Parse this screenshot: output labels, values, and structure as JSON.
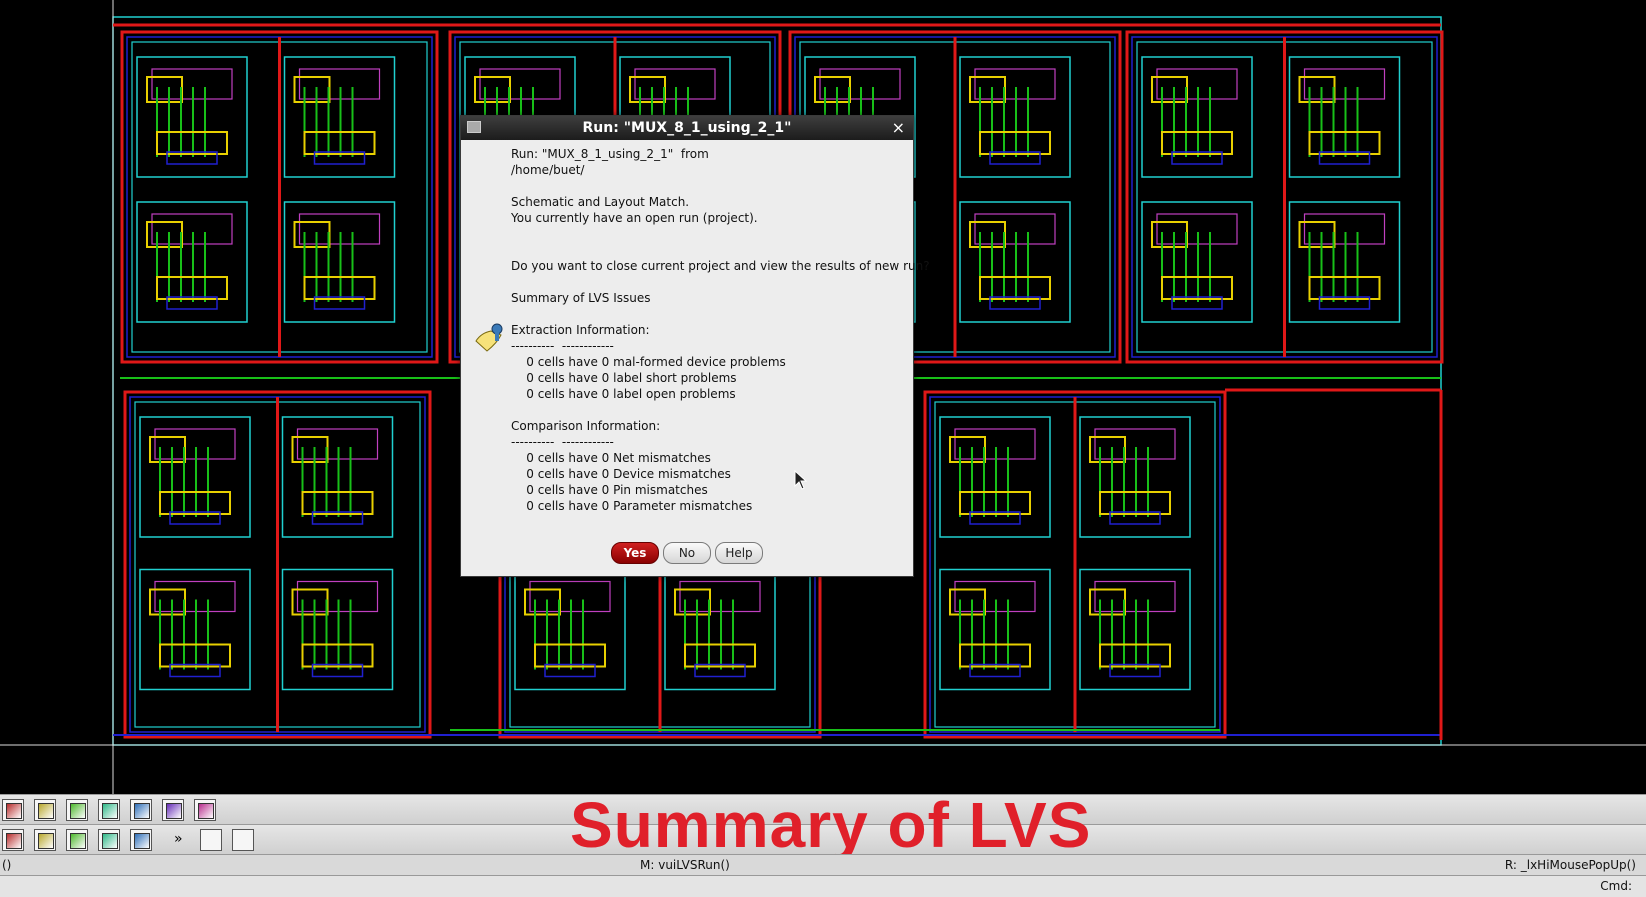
{
  "dialog": {
    "title": "Run: \"MUX_8_1_using_2_1\"",
    "close_glyph": "×",
    "lines": [
      "Run: \"MUX_8_1_using_2_1\"  from",
      "/home/buet/",
      "",
      "Schematic and Layout Match.",
      "You currently have an open run (project).",
      "",
      "",
      "Do you want to close current project and view the results of new run?",
      "",
      "Summary of LVS Issues",
      "",
      "Extraction Information:",
      "----------  ------------",
      "    0 cells have 0 mal-formed device problems",
      "    0 cells have 0 label short problems",
      "    0 cells have 0 label open problems",
      "",
      "Comparison Information:",
      "----------  ------------",
      "    0 cells have 0 Net mismatches",
      "    0 cells have 0 Device mismatches",
      "    0 cells have 0 Pin mismatches",
      "    0 cells have 0 Parameter mismatches"
    ],
    "buttons": {
      "yes": "Yes",
      "no": "No",
      "help": "Help"
    },
    "icon": "note-info-icon"
  },
  "overlay_caption": "Summary of LVS",
  "status_bar": {
    "left": "()",
    "middle": "M: vuiLVSRun()",
    "right": "R: _lxHiMousePopUp()"
  },
  "cmd_bar": {
    "label": "Cmd:"
  },
  "toolbar_icons": {
    "row1": [
      "ruler-icon",
      "eye-icon",
      "select-icon",
      "zoom-box-icon",
      "fit-icon",
      "zoom-in-icon",
      "swap-icon"
    ],
    "row2": [
      "grid-icon",
      "lvs-icon",
      "hierarchy-icon",
      "error-icon",
      "edit-icon",
      "more-icon",
      "table-icon",
      "table-alt-icon"
    ],
    "more_glyph": "»"
  },
  "colors": {
    "metal1": "#2020d0",
    "metal2": "#e01818",
    "poly": "#18c018",
    "active": "#e8d000",
    "nwell": "#20d0d0",
    "contact": "#c040c0"
  }
}
